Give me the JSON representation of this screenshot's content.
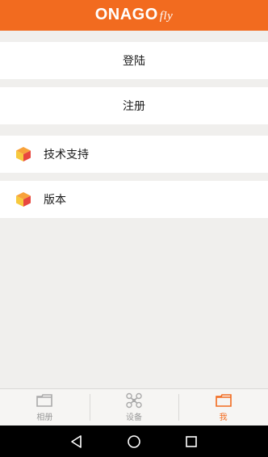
{
  "header": {
    "logo_main": "ONAGO",
    "logo_sub": "fly"
  },
  "menu": {
    "login_label": "登陆",
    "register_label": "注册",
    "support_label": "技术支持",
    "version_label": "版本"
  },
  "tabs": [
    {
      "label": "相册",
      "icon": "album-icon",
      "active": false
    },
    {
      "label": "设备",
      "icon": "drone-icon",
      "active": false
    },
    {
      "label": "我",
      "icon": "me-icon",
      "active": true
    }
  ],
  "system_nav": {
    "back_icon": "back-triangle-icon",
    "home_icon": "home-circle-icon",
    "recents_icon": "recents-square-icon"
  },
  "colors": {
    "brand": "#f26b1f",
    "background": "#f0efed",
    "tab_inactive": "#999999"
  }
}
